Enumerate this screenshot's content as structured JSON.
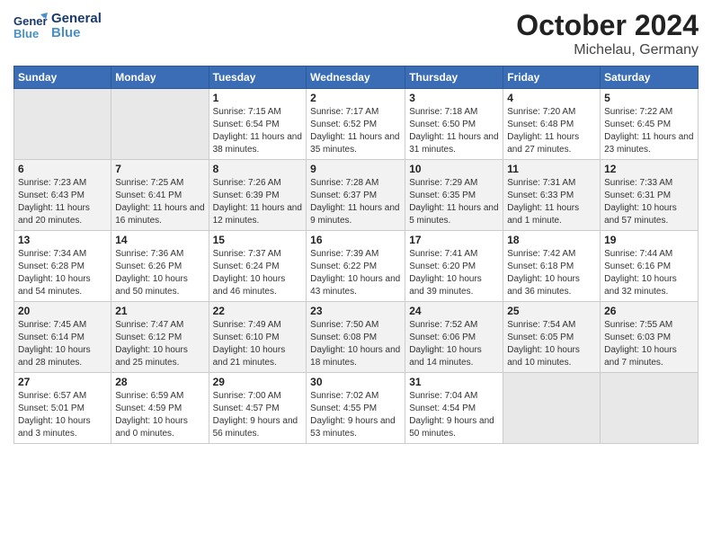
{
  "header": {
    "logo_line1": "General",
    "logo_line2": "Blue",
    "month_year": "October 2024",
    "location": "Michelau, Germany"
  },
  "weekdays": [
    "Sunday",
    "Monday",
    "Tuesday",
    "Wednesday",
    "Thursday",
    "Friday",
    "Saturday"
  ],
  "weeks": [
    [
      {
        "day": "",
        "info": ""
      },
      {
        "day": "",
        "info": ""
      },
      {
        "day": "1",
        "info": "Sunrise: 7:15 AM\nSunset: 6:54 PM\nDaylight: 11 hours and 38 minutes."
      },
      {
        "day": "2",
        "info": "Sunrise: 7:17 AM\nSunset: 6:52 PM\nDaylight: 11 hours and 35 minutes."
      },
      {
        "day": "3",
        "info": "Sunrise: 7:18 AM\nSunset: 6:50 PM\nDaylight: 11 hours and 31 minutes."
      },
      {
        "day": "4",
        "info": "Sunrise: 7:20 AM\nSunset: 6:48 PM\nDaylight: 11 hours and 27 minutes."
      },
      {
        "day": "5",
        "info": "Sunrise: 7:22 AM\nSunset: 6:45 PM\nDaylight: 11 hours and 23 minutes."
      }
    ],
    [
      {
        "day": "6",
        "info": "Sunrise: 7:23 AM\nSunset: 6:43 PM\nDaylight: 11 hours and 20 minutes."
      },
      {
        "day": "7",
        "info": "Sunrise: 7:25 AM\nSunset: 6:41 PM\nDaylight: 11 hours and 16 minutes."
      },
      {
        "day": "8",
        "info": "Sunrise: 7:26 AM\nSunset: 6:39 PM\nDaylight: 11 hours and 12 minutes."
      },
      {
        "day": "9",
        "info": "Sunrise: 7:28 AM\nSunset: 6:37 PM\nDaylight: 11 hours and 9 minutes."
      },
      {
        "day": "10",
        "info": "Sunrise: 7:29 AM\nSunset: 6:35 PM\nDaylight: 11 hours and 5 minutes."
      },
      {
        "day": "11",
        "info": "Sunrise: 7:31 AM\nSunset: 6:33 PM\nDaylight: 11 hours and 1 minute."
      },
      {
        "day": "12",
        "info": "Sunrise: 7:33 AM\nSunset: 6:31 PM\nDaylight: 10 hours and 57 minutes."
      }
    ],
    [
      {
        "day": "13",
        "info": "Sunrise: 7:34 AM\nSunset: 6:28 PM\nDaylight: 10 hours and 54 minutes."
      },
      {
        "day": "14",
        "info": "Sunrise: 7:36 AM\nSunset: 6:26 PM\nDaylight: 10 hours and 50 minutes."
      },
      {
        "day": "15",
        "info": "Sunrise: 7:37 AM\nSunset: 6:24 PM\nDaylight: 10 hours and 46 minutes."
      },
      {
        "day": "16",
        "info": "Sunrise: 7:39 AM\nSunset: 6:22 PM\nDaylight: 10 hours and 43 minutes."
      },
      {
        "day": "17",
        "info": "Sunrise: 7:41 AM\nSunset: 6:20 PM\nDaylight: 10 hours and 39 minutes."
      },
      {
        "day": "18",
        "info": "Sunrise: 7:42 AM\nSunset: 6:18 PM\nDaylight: 10 hours and 36 minutes."
      },
      {
        "day": "19",
        "info": "Sunrise: 7:44 AM\nSunset: 6:16 PM\nDaylight: 10 hours and 32 minutes."
      }
    ],
    [
      {
        "day": "20",
        "info": "Sunrise: 7:45 AM\nSunset: 6:14 PM\nDaylight: 10 hours and 28 minutes."
      },
      {
        "day": "21",
        "info": "Sunrise: 7:47 AM\nSunset: 6:12 PM\nDaylight: 10 hours and 25 minutes."
      },
      {
        "day": "22",
        "info": "Sunrise: 7:49 AM\nSunset: 6:10 PM\nDaylight: 10 hours and 21 minutes."
      },
      {
        "day": "23",
        "info": "Sunrise: 7:50 AM\nSunset: 6:08 PM\nDaylight: 10 hours and 18 minutes."
      },
      {
        "day": "24",
        "info": "Sunrise: 7:52 AM\nSunset: 6:06 PM\nDaylight: 10 hours and 14 minutes."
      },
      {
        "day": "25",
        "info": "Sunrise: 7:54 AM\nSunset: 6:05 PM\nDaylight: 10 hours and 10 minutes."
      },
      {
        "day": "26",
        "info": "Sunrise: 7:55 AM\nSunset: 6:03 PM\nDaylight: 10 hours and 7 minutes."
      }
    ],
    [
      {
        "day": "27",
        "info": "Sunrise: 6:57 AM\nSunset: 5:01 PM\nDaylight: 10 hours and 3 minutes."
      },
      {
        "day": "28",
        "info": "Sunrise: 6:59 AM\nSunset: 4:59 PM\nDaylight: 10 hours and 0 minutes."
      },
      {
        "day": "29",
        "info": "Sunrise: 7:00 AM\nSunset: 4:57 PM\nDaylight: 9 hours and 56 minutes."
      },
      {
        "day": "30",
        "info": "Sunrise: 7:02 AM\nSunset: 4:55 PM\nDaylight: 9 hours and 53 minutes."
      },
      {
        "day": "31",
        "info": "Sunrise: 7:04 AM\nSunset: 4:54 PM\nDaylight: 9 hours and 50 minutes."
      },
      {
        "day": "",
        "info": ""
      },
      {
        "day": "",
        "info": ""
      }
    ]
  ]
}
